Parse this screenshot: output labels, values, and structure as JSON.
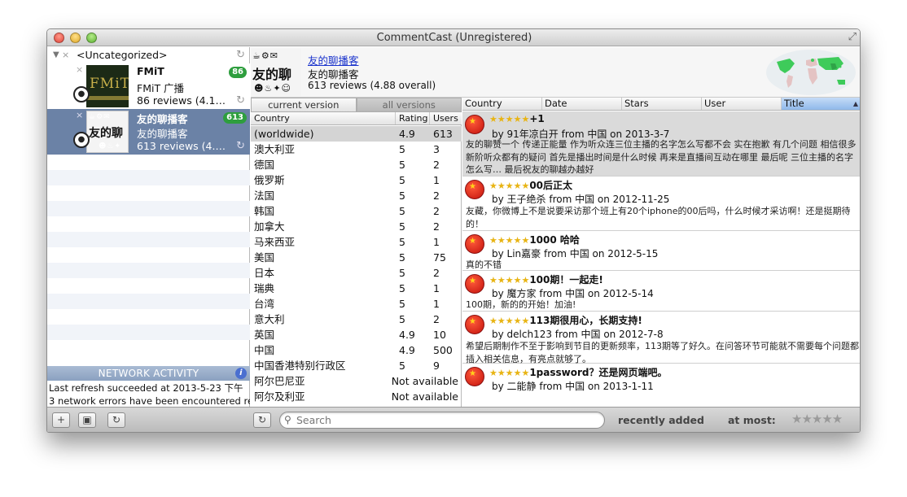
{
  "window": {
    "title": "CommentCast (Unregistered)"
  },
  "sidebar": {
    "group": "<Uncategorized>",
    "podcasts": [
      {
        "title": "FMiT",
        "subtitle": "FMiT 广播",
        "reviews": "86 reviews (4.1…",
        "badge": "86",
        "art_text": "FMiT"
      },
      {
        "title": "友的聊播客",
        "subtitle": "友的聊播客",
        "reviews": "613 reviews (4.…",
        "badge": "613",
        "art_text": "友的聊"
      }
    ],
    "network": {
      "heading": "NETWORK ACTIVITY",
      "lines": [
        "Last refresh succeeded at 2013-5-23 下午",
        "3 network errors have been encountered re"
      ]
    }
  },
  "header": {
    "title": "友的聊播客",
    "subtitle": "友的聊播客",
    "reviews": "613 reviews (4.88 overall)",
    "art_text": "友的聊"
  },
  "country_panel": {
    "tabs": [
      "current version",
      "all versions"
    ],
    "columns": [
      "Country",
      "Rating",
      "Users"
    ],
    "rows": [
      {
        "country": "(worldwide)",
        "rating": "4.9",
        "users": "613"
      },
      {
        "country": "澳大利亚",
        "rating": "5",
        "users": "3"
      },
      {
        "country": "德国",
        "rating": "5",
        "users": "2"
      },
      {
        "country": "俄罗斯",
        "rating": "5",
        "users": "1"
      },
      {
        "country": "法国",
        "rating": "5",
        "users": "2"
      },
      {
        "country": "韩国",
        "rating": "5",
        "users": "2"
      },
      {
        "country": "加拿大",
        "rating": "5",
        "users": "2"
      },
      {
        "country": "马来西亚",
        "rating": "5",
        "users": "1"
      },
      {
        "country": "美国",
        "rating": "5",
        "users": "75"
      },
      {
        "country": "日本",
        "rating": "5",
        "users": "2"
      },
      {
        "country": "瑞典",
        "rating": "5",
        "users": "1"
      },
      {
        "country": "台湾",
        "rating": "5",
        "users": "1"
      },
      {
        "country": "意大利",
        "rating": "5",
        "users": "2"
      },
      {
        "country": "英国",
        "rating": "4.9",
        "users": "10"
      },
      {
        "country": "中国",
        "rating": "4.9",
        "users": "500"
      },
      {
        "country": "中国香港特别行政区",
        "rating": "5",
        "users": "9"
      },
      {
        "country": "阿尔巴尼亚",
        "rating": "",
        "users": "",
        "na": "Not available"
      },
      {
        "country": "阿尔及利亚",
        "rating": "",
        "users": "",
        "na": "Not available"
      }
    ]
  },
  "reviews_panel": {
    "columns": [
      "Country",
      "Date",
      "Stars",
      "User",
      "Title"
    ],
    "reviews": [
      {
        "stars": "★★★★★",
        "title": "+1",
        "byline": "by 91年凉白开 from 中国 on 2013-3-7",
        "body": "友的聊赞一个 传递正能量 作为听众连三位主播的名字怎么写都不会 实在抱歉 有几个问题 相信很多新阶听众都有的疑问 首先是播出时间是什么时候 再来是直播间互动在哪里 最后呢 三位主播的名字怎么写… 最后祝友的聊越办越好"
      },
      {
        "stars": "★★★★★",
        "title": "00后正太",
        "byline": "by 王子绝杀 from 中国 on 2012-11-25",
        "body": "友藏，你微博上不是说要采访那个班上有20个iphone的00后吗，什么时候才采访啊！还是挺期待的！"
      },
      {
        "stars": "★★★★★",
        "title": "1000 哈哈",
        "byline": "by Lin嘉豪 from 中国 on 2012-5-15",
        "body": "真的不错"
      },
      {
        "stars": "★★★★★",
        "title": "100期！一起走!",
        "byline": "by 魔方家 from 中国 on 2012-5-14",
        "body": "100期，新的的开始！加油!"
      },
      {
        "stars": "★★★★★",
        "title": "113期很用心，长期支持!",
        "byline": "by delch123 from 中国 on 2012-7-8",
        "body": "希望后期制作不至于影响到节目的更新频率，113期等了好久。在问答环节可能就不需要每个问题都插入相关信息，有亮点就够了。"
      },
      {
        "stars": "★★★★★",
        "title": "1password？还是网页端吧。",
        "byline": "by 二能静 from 中国 on 2013-1-11",
        "body": ""
      }
    ]
  },
  "bottombar": {
    "search_placeholder": "Search",
    "sort_label": "recently added",
    "at_most_label": "at most:",
    "at_most_stars": "★★★★★"
  },
  "colors": {
    "selection": "#6b82a6",
    "badge": "#2e9e3e",
    "link": "#1a33cc",
    "star": "#e8b413"
  }
}
